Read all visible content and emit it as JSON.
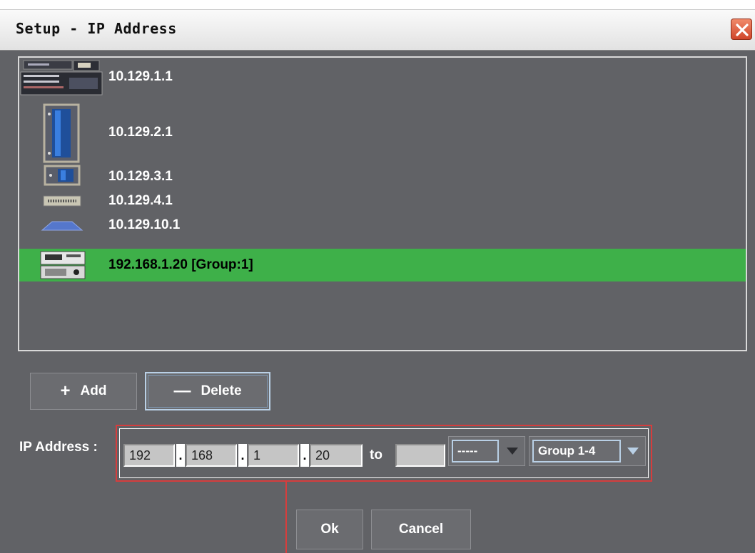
{
  "window": {
    "title": "Setup - IP Address"
  },
  "devices": [
    {
      "icon": "rack-switch-icon",
      "ip": "10.129.1.1",
      "selected": false
    },
    {
      "icon": "tower-server-icon",
      "ip": "10.129.2.1",
      "selected": false
    },
    {
      "icon": "small-server-icon",
      "ip": "10.129.3.1",
      "selected": false
    },
    {
      "icon": "patch-panel-icon",
      "ip": "10.129.4.1",
      "selected": false
    },
    {
      "icon": "router-icon",
      "ip": "10.129.10.1",
      "selected": false
    },
    {
      "icon": "recorder-device-icon",
      "ip": "192.168.1.20 [Group:1]",
      "selected": true
    }
  ],
  "buttons": {
    "add": "Add",
    "add_symbol": "+",
    "delete": "Delete",
    "delete_symbol": "—",
    "ok": "Ok",
    "cancel": "Cancel"
  },
  "ip_form": {
    "label": "IP Address :",
    "octets": [
      "192",
      "168",
      "1",
      "20"
    ],
    "separator": ".",
    "to_label": "to",
    "range_end": "",
    "range_select": "-----",
    "group_select": "Group 1-4"
  },
  "colors": {
    "panel_bg": "#616266",
    "selected_row": "#3eb049",
    "highlight": "#d63d3d"
  }
}
